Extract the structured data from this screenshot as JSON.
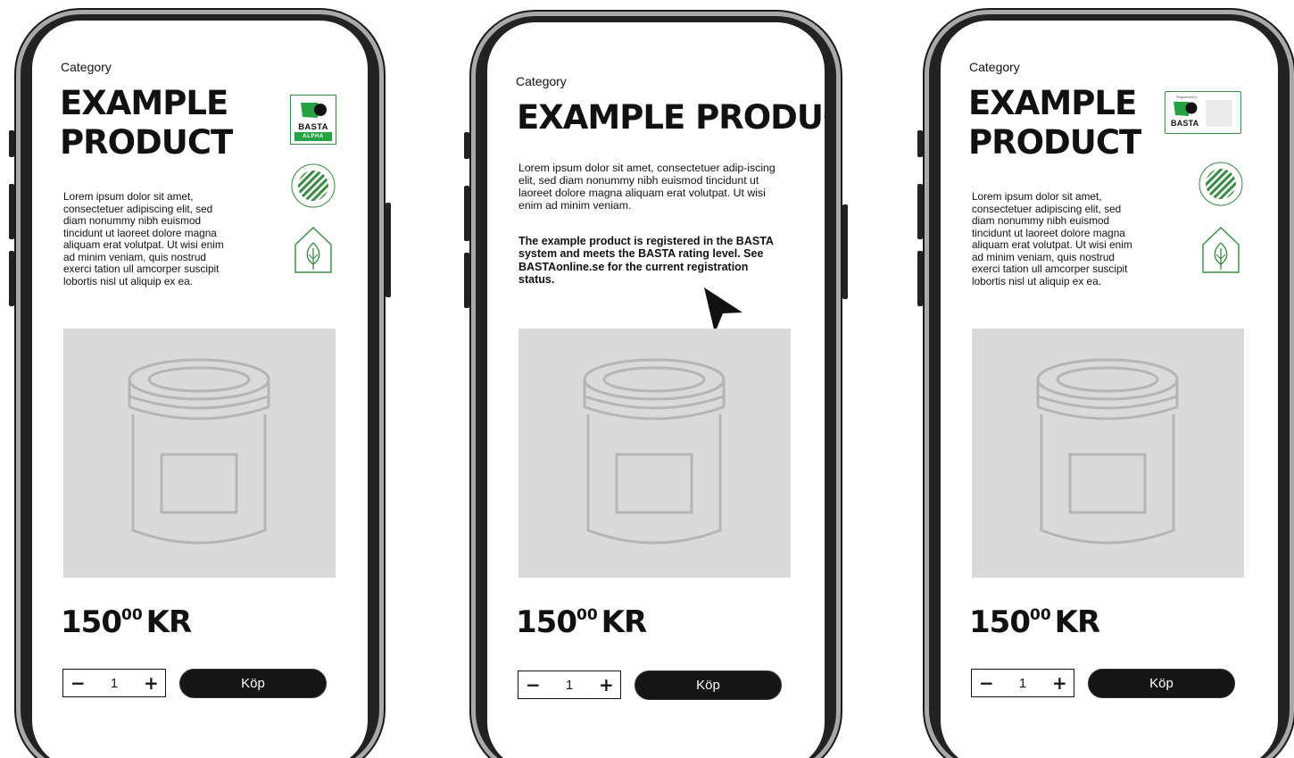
{
  "colors": {
    "frame_gray": "#a9a9a9",
    "frame_dark": "#222222",
    "image_bg": "#dadada",
    "jar_stroke": "#b5b5b5",
    "eco_green": "#3a8a46",
    "basta_green": "#25a244",
    "button_dark": "#151515"
  },
  "icons": {
    "basta_logo": "basta-logo-icon",
    "nordic_swan": "swan-ecolabel-icon",
    "leaf_house": "leaf-house-icon",
    "jar": "jar-icon",
    "cursor": "cursor-arrow-icon"
  },
  "phones": [
    {
      "variant": "basta-alpha",
      "category": "Category",
      "title_lines": [
        "EXAMPLE",
        "PRODUCT"
      ],
      "description": "Lorem ipsum dolor sit amet, consectetuer adipiscing elit, sed diam nonummy nibh euismod tincidunt ut laoreet dolore magna aliquam erat volutpat. Ut wisi enim ad minim veniam, quis nostrud exerci tation ull amcorper suscipit lobortis nisl ut aliquip ex ea.",
      "badge_basta": {
        "word": "BASTA",
        "sub": "ALPHA"
      },
      "price": {
        "main": "150",
        "cents": "00",
        "currency": "KR"
      },
      "quantity": {
        "minus": "−",
        "value": "1",
        "plus": "+"
      },
      "buy_label": "Köp"
    },
    {
      "variant": "info",
      "category": "Category",
      "title": "EXAMPLE PRODUCT",
      "description": "Lorem ipsum dolor sit amet, consectetuer adip-iscing elit, sed diam nonummy nibh euismod tincidunt ut laoreet dolore magna aliquam erat volutpat. Ut wisi enim ad minim veniam.",
      "registration_note": "The example product is registered in the BASTA system and meets the BASTA rating level. See BASTAonline.se for the current registration status.",
      "price": {
        "main": "150",
        "cents": "00",
        "currency": "KR"
      },
      "quantity": {
        "minus": "−",
        "value": "1",
        "plus": "+"
      },
      "buy_label": "Köp"
    },
    {
      "variant": "basta-registered",
      "category": "Category",
      "title_lines": [
        "EXAMPLE",
        "PRODUCT"
      ],
      "description": "Lorem ipsum dolor sit amet, consectetuer adipiscing elit, sed diam nonummy nibh euismod tincidunt ut laoreet dolore magna aliquam erat volutpat. Ut wisi enim ad minim veniam, quis nostrud exerci tation ull amcorper suscipit lobortis nisl ut aliquip ex ea.",
      "badge_basta": {
        "word": "BASTA",
        "top_label": "Registered in"
      },
      "price": {
        "main": "150",
        "cents": "00",
        "currency": "KR"
      },
      "quantity": {
        "minus": "−",
        "value": "1",
        "plus": "+"
      },
      "buy_label": "Köp"
    }
  ]
}
